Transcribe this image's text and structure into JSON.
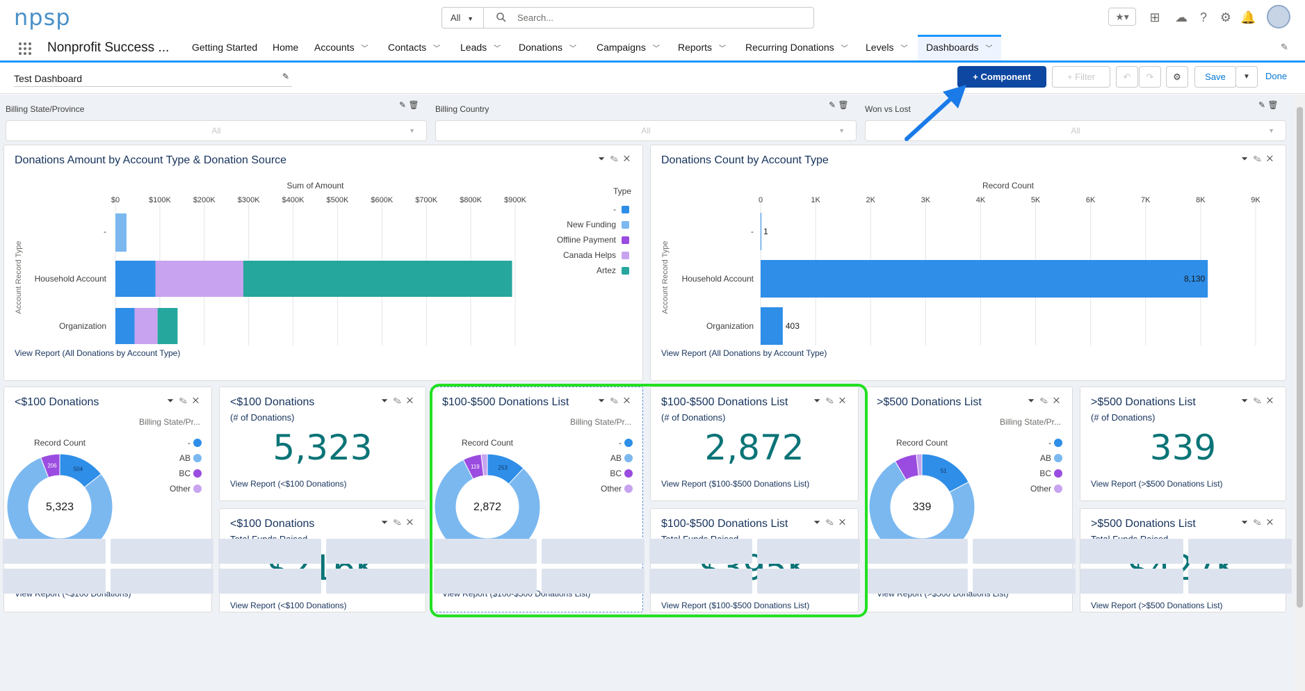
{
  "header": {
    "logo": "npsp",
    "search_scope": "All",
    "search_placeholder": "Search..."
  },
  "nav": {
    "app_name": "Nonprofit Success ...",
    "tabs": [
      "Getting Started",
      "Home",
      "Accounts",
      "Contacts",
      "Leads",
      "Donations",
      "Campaigns",
      "Reports",
      "Recurring Donations",
      "Levels",
      "Dashboards"
    ]
  },
  "toolbar": {
    "dashboard_title": "Test Dashboard",
    "component": "+ Component",
    "filter": "+ Filter",
    "save": "Save",
    "done": "Done"
  },
  "filters": [
    {
      "label": "Billing State/Province",
      "value": "All"
    },
    {
      "label": "Billing Country",
      "value": "All"
    },
    {
      "label": "Won vs Lost",
      "value": "All"
    }
  ],
  "chart1": {
    "title": "Donations Amount by Account Type & Donation Source",
    "link": "View Report (All Donations by Account Type)"
  },
  "chart2": {
    "title": "Donations Count by Account Type",
    "link": "View Report (All Donations by Account Type)"
  },
  "chart_data": [
    {
      "type": "bar",
      "orientation": "horizontal",
      "stacked": true,
      "xlabel": "Sum of Amount",
      "ylabel": "Account Record Type",
      "legend_title": "Type",
      "legend_placement": "right",
      "categories": [
        "-",
        "Household Account",
        "Organization"
      ],
      "x_ticks": [
        "$0",
        "$100K",
        "$200K",
        "$300K",
        "$400K",
        "$500K",
        "$600K",
        "$700K",
        "$800K",
        "$900K"
      ],
      "xlim": [
        0,
        900000
      ],
      "series": [
        {
          "name": "-",
          "color": "#2e8ee8",
          "values": [
            0,
            90000,
            43000
          ]
        },
        {
          "name": "New Funding",
          "color": "#7bb8f0",
          "values": [
            25000,
            0,
            0
          ]
        },
        {
          "name": "Offline Payment",
          "color": "#9b4ce0",
          "values": [
            0,
            0,
            0
          ]
        },
        {
          "name": "Canada Helps",
          "color": "#c7a3f0",
          "values": [
            0,
            198000,
            52000
          ]
        },
        {
          "name": "Artez",
          "color": "#26a79d",
          "values": [
            0,
            605000,
            45000
          ]
        }
      ]
    },
    {
      "type": "bar",
      "orientation": "horizontal",
      "xlabel": "Record Count",
      "ylabel": "Account Record Type",
      "categories": [
        "-",
        "Household Account",
        "Organization"
      ],
      "values": [
        1,
        8130,
        403
      ],
      "value_labels": [
        "1",
        "8,130",
        "403"
      ],
      "x_ticks": [
        "0",
        "1K",
        "2K",
        "3K",
        "4K",
        "5K",
        "6K",
        "7K",
        "8K",
        "9K"
      ],
      "xlim": [
        0,
        9000
      ]
    },
    {
      "type": "pie",
      "donut": true,
      "label": "Record Count",
      "center": "5,323",
      "legend_title": "Billing State/Pr...",
      "categories": [
        "-",
        "AB",
        "BC",
        "Other"
      ],
      "values": [
        504,
        2800,
        206,
        0
      ],
      "slice_labels": [
        "504",
        "2.8K",
        "206",
        ""
      ]
    },
    {
      "type": "pie",
      "donut": true,
      "label": "Record Count",
      "center": "2,872",
      "legend_title": "Billing State/Pr...",
      "categories": [
        "-",
        "AB",
        "BC",
        "Other"
      ],
      "values": [
        253,
        1700,
        119,
        40
      ],
      "slice_labels": [
        "253",
        "1.7K",
        "119",
        ""
      ]
    },
    {
      "type": "pie",
      "donut": true,
      "label": "Record Count",
      "center": "339",
      "legend_title": "Billing State/Pr...",
      "categories": [
        "-",
        "AB",
        "BC",
        "Other"
      ],
      "values": [
        51,
        220,
        20,
        5
      ],
      "slice_labels": [
        "51",
        "220",
        "",
        ""
      ]
    }
  ],
  "legend_colors": [
    "#2e8ee8",
    "#7bb8f0",
    "#9b4ce0",
    "#c7a3f0"
  ],
  "cards": {
    "d1": {
      "title": "<$100 Donations",
      "link": "View Report (<$100 Donations)"
    },
    "m1": {
      "title": "<$100 Donations",
      "sub": "(# of Donations)",
      "value": "5,323",
      "link": "View Report (<$100 Donations)"
    },
    "m2": {
      "title": "<$100 Donations",
      "sub": "Total Funds Raised",
      "value": "$216K",
      "link": "View Report (<$100 Donations)"
    },
    "d2": {
      "title": "$100-$500 Donations List",
      "link": "View Report ($100-$500 Donations List)"
    },
    "m3": {
      "title": "$100-$500 Donations List",
      "sub": "(# of Donations)",
      "value": "2,872",
      "link": "View Report ($100-$500 Donations List)"
    },
    "m4": {
      "title": "$100-$500 Donations List",
      "sub": "Total Funds Raised",
      "value": "$395K",
      "link": "View Report ($100-$500 Donations List)"
    },
    "d3": {
      "title": ">$500 Donations List",
      "link": "View Report (>$500 Donations List)"
    },
    "m5": {
      "title": ">$500 Donations List",
      "sub": "(# of Donations)",
      "value": "339",
      "link": "View Report (>$500 Donations List)"
    },
    "m6": {
      "title": ">$500 Donations List",
      "sub": "Total Funds Raised",
      "value": "$427K",
      "link": "View Report (>$500 Donations List)"
    }
  }
}
